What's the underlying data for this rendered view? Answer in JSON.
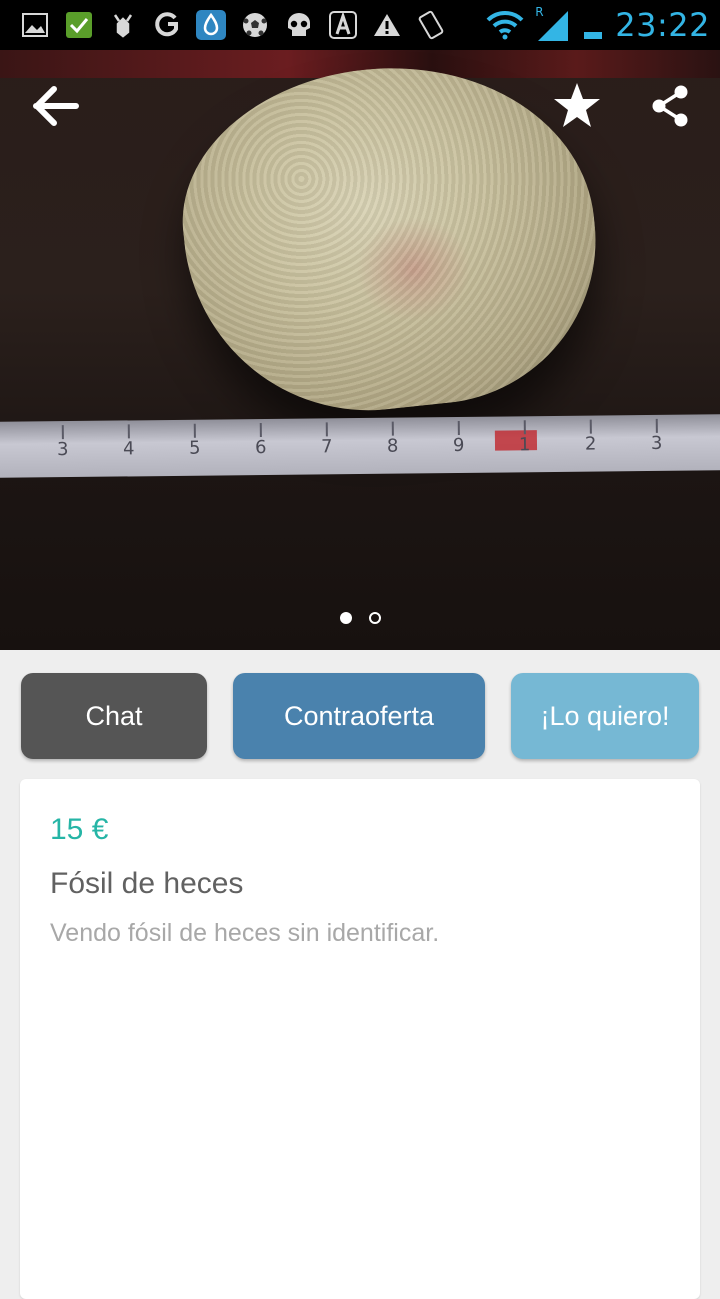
{
  "status_bar": {
    "time": "23:22",
    "icons": [
      "image-icon",
      "check-icon",
      "bug-icon",
      "g-icon",
      "drop-icon",
      "soccer-ball-icon",
      "skull-icon",
      "a-icon",
      "warning-icon",
      "rotate-icon",
      "wifi-icon",
      "signal-icon",
      "battery-icon"
    ],
    "roaming": "R"
  },
  "photo": {
    "ruler_numbers": [
      "3",
      "4",
      "5",
      "6",
      "7",
      "8",
      "9",
      "1",
      "2",
      "3"
    ],
    "page_count": 2,
    "active_page": 1
  },
  "toolbar": {
    "back_icon": "arrow-left-icon",
    "favorite_icon": "star-icon",
    "share_icon": "share-icon"
  },
  "actions": {
    "chat_label": "Chat",
    "counteroffer_label": "Contraoferta",
    "want_label": "¡Lo quiero!"
  },
  "listing": {
    "price": "15 €",
    "title": "Fósil de heces",
    "description": "Vendo fósil de heces sin identificar."
  },
  "colors": {
    "price": "#26b5a6",
    "chat_button": "#555555",
    "counteroffer_button": "#4a82ad",
    "want_button": "#76b8d4",
    "clock": "#33b5e5"
  }
}
